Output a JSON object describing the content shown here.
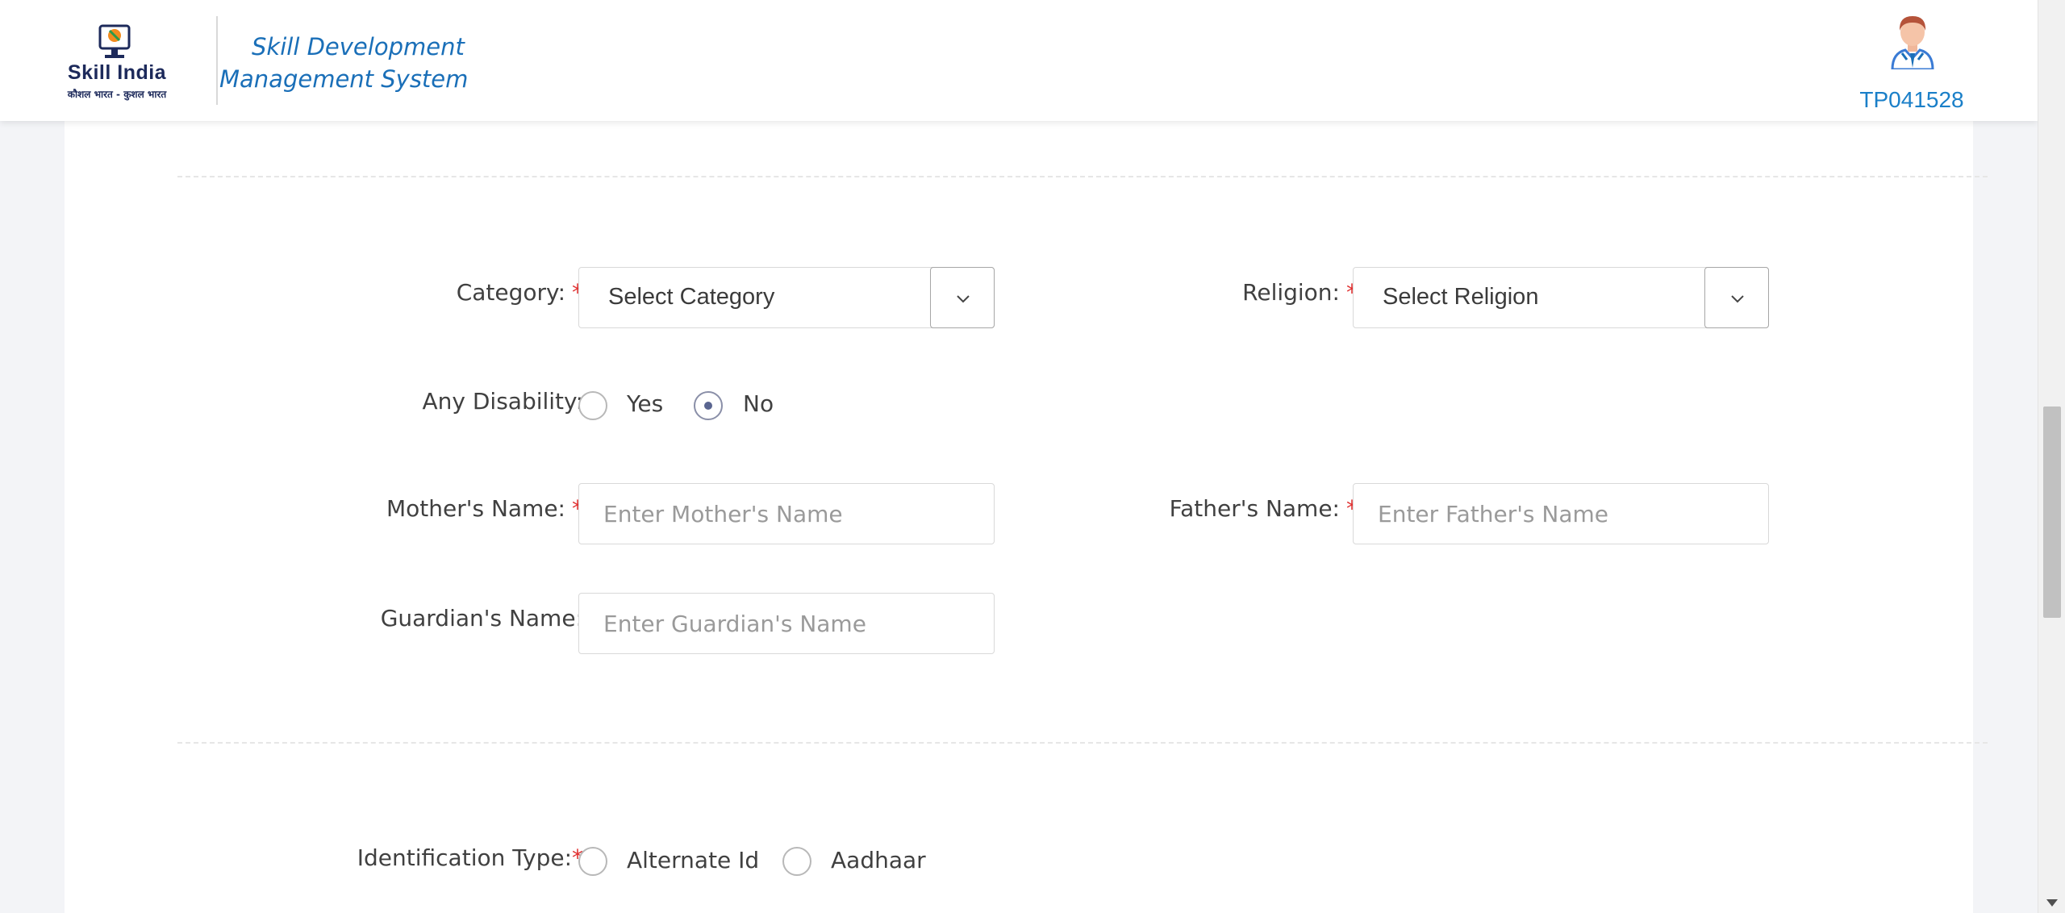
{
  "header": {
    "logo_text": "Skill India",
    "logo_subtext": "कौशल भारत - कुशल भारत",
    "app_title": "Skill Development Management System",
    "user_id": "TP041528"
  },
  "form": {
    "category": {
      "label": "Category:",
      "required_mark": "*",
      "selected": "Select Category"
    },
    "religion": {
      "label": "Religion:",
      "required_mark": "*",
      "selected": "Select Religion"
    },
    "disability": {
      "label": "Any Disability:",
      "options": [
        "Yes",
        "No"
      ],
      "selected": "No"
    },
    "mother_name": {
      "label": "Mother's Name:",
      "required_mark": "*",
      "placeholder": "Enter Mother's Name",
      "value": ""
    },
    "father_name": {
      "label": "Father's Name:",
      "required_mark": "*",
      "placeholder": "Enter Father's Name",
      "value": ""
    },
    "guardian_name": {
      "label": "Guardian's Name:",
      "placeholder": "Enter Guardian's Name",
      "value": ""
    },
    "identification_type": {
      "label": "Identification Type:",
      "required_mark": "*",
      "options": [
        "Alternate Id",
        "Aadhaar"
      ],
      "selected": ""
    }
  },
  "colors": {
    "brand_blue": "#1a6fb8",
    "required_red": "#e03131",
    "logo_navy": "#1d2a5b"
  }
}
